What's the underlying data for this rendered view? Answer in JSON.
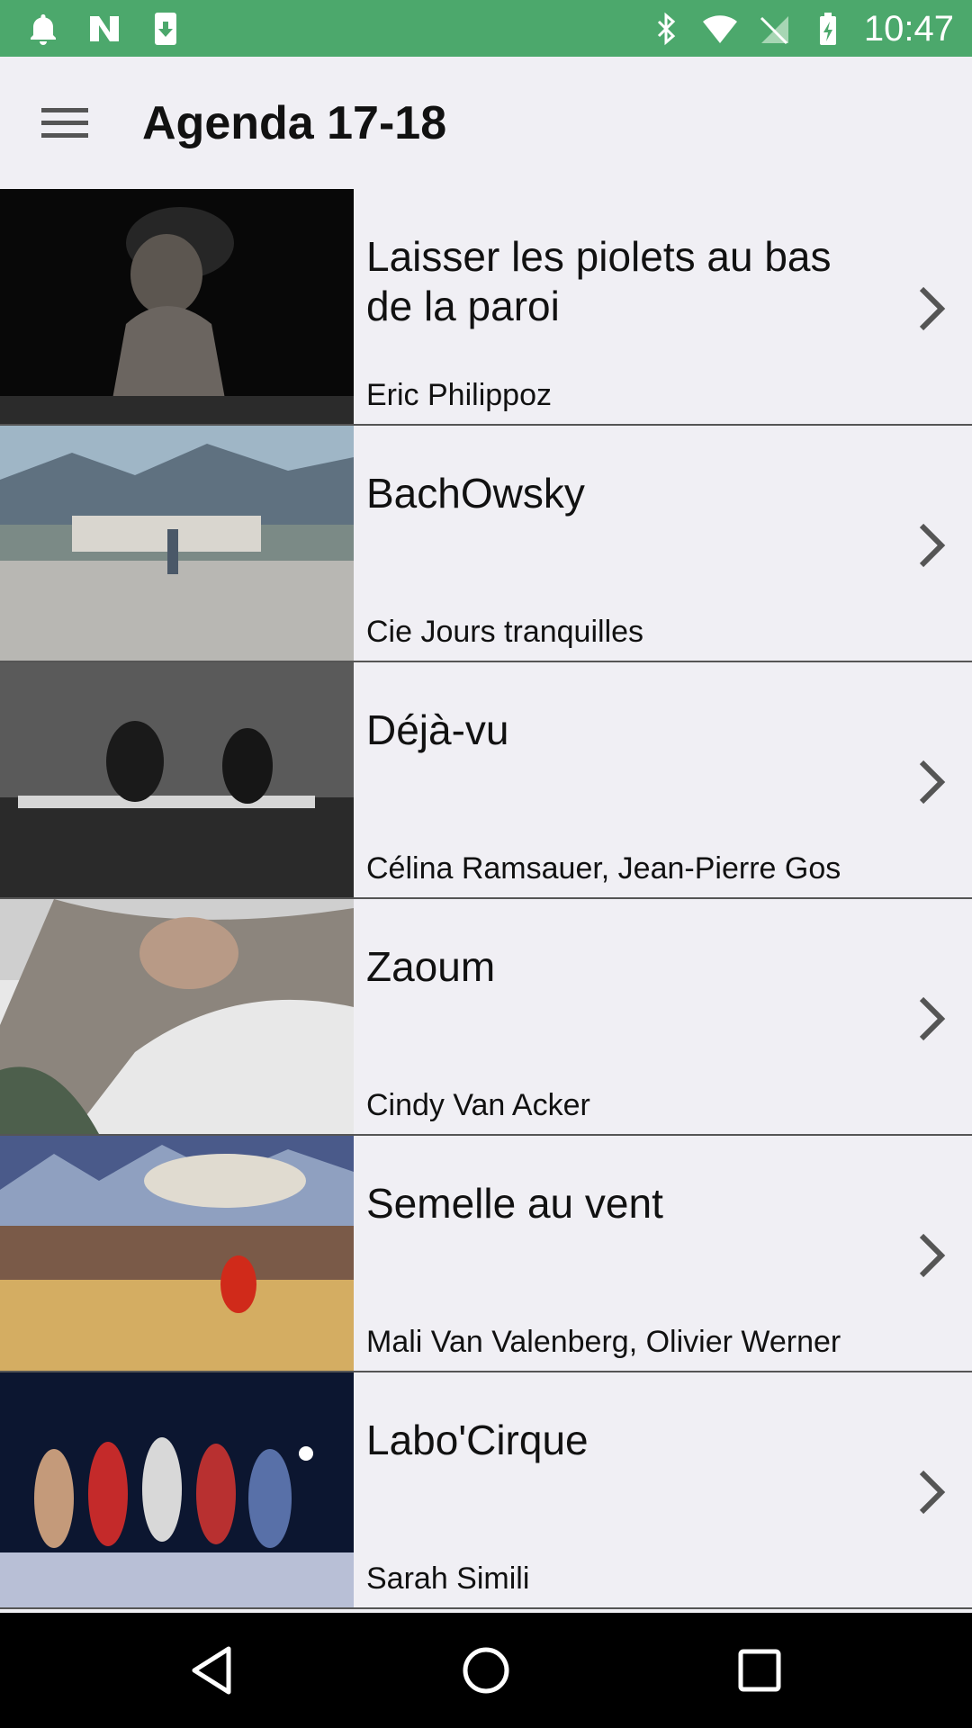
{
  "status_bar": {
    "time": "10:47",
    "icons": [
      "notification-bell-icon",
      "n-app-icon",
      "download-icon",
      "bluetooth-icon",
      "wifi-icon",
      "no-sim-icon",
      "battery-charging-icon"
    ]
  },
  "app_bar": {
    "title": "Agenda 17-18",
    "menu_icon": "hamburger-menu-icon"
  },
  "events": [
    {
      "title": "Laisser les piolets au bas de la paroi",
      "subtitle": "Eric Philippoz"
    },
    {
      "title": "BachOwsky",
      "subtitle": "Cie Jours tranquilles"
    },
    {
      "title": "Déjà-vu",
      "subtitle": "Célina Ramsauer, Jean-Pierre Gos"
    },
    {
      "title": "Zaoum",
      "subtitle": "Cindy Van Acker"
    },
    {
      "title": "Semelle au vent",
      "subtitle": "Mali Van Valenberg, Olivier Werner"
    },
    {
      "title": "Labo'Cirque",
      "subtitle": "Sarah Simili"
    }
  ],
  "nav_bar": {
    "back_icon": "back-triangle-icon",
    "home_icon": "home-circle-icon",
    "recents_icon": "recents-square-icon"
  }
}
